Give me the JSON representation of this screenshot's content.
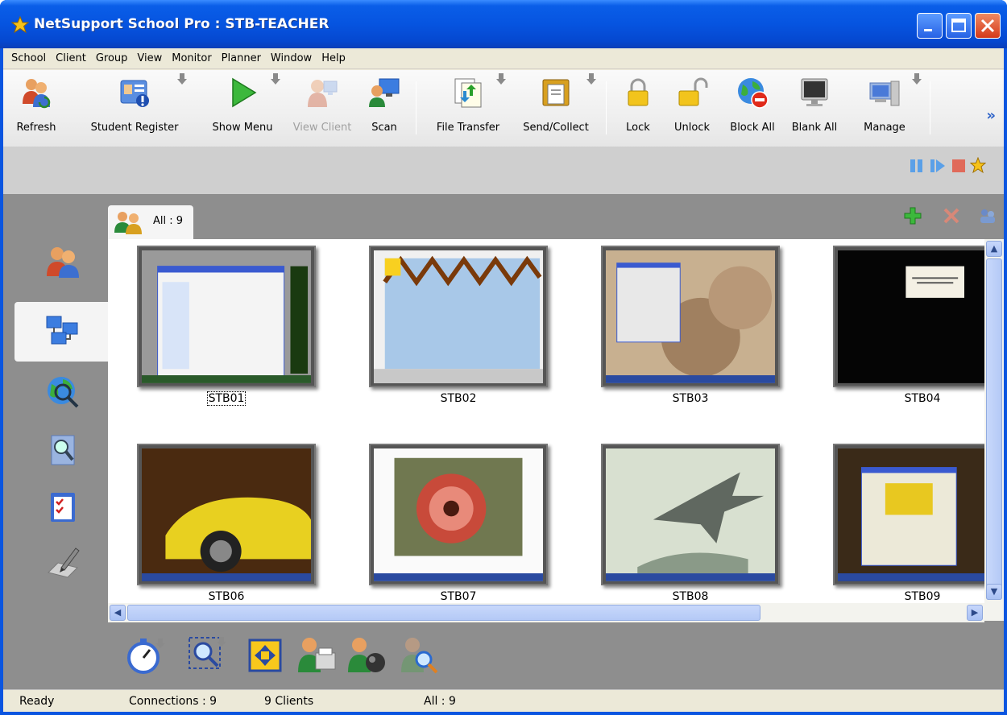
{
  "window": {
    "title": "NetSupport School Pro : STB-TEACHER"
  },
  "menu": [
    "School",
    "Client",
    "Group",
    "View",
    "Monitor",
    "Planner",
    "Window",
    "Help"
  ],
  "toolbar": {
    "refresh": "Refresh",
    "student_register": "Student Register",
    "show_menu": "Show Menu",
    "view_client": "View Client",
    "scan": "Scan",
    "file_transfer": "File Transfer",
    "send_collect": "Send/Collect",
    "lock": "Lock",
    "unlock": "Unlock",
    "block_all": "Block All",
    "blank_all": "Blank All",
    "manage": "Manage",
    "more": "»"
  },
  "group_tab": {
    "label": "All : 9"
  },
  "clients": [
    {
      "name": "STB01",
      "selected": true
    },
    {
      "name": "STB02",
      "selected": false
    },
    {
      "name": "STB03",
      "selected": false
    },
    {
      "name": "STB04",
      "selected": false
    },
    {
      "name": "STB06",
      "selected": false
    },
    {
      "name": "STB07",
      "selected": false
    },
    {
      "name": "STB08",
      "selected": false
    },
    {
      "name": "STB09",
      "selected": false
    }
  ],
  "status": {
    "state": "Ready",
    "connections": "Connections : 9",
    "clients": "9 Clients",
    "group": "All : 9"
  },
  "colors": {
    "title_bar": "#0654e0",
    "panel_gray": "#8e8e8e",
    "toolbar_bg": "#ececec"
  }
}
